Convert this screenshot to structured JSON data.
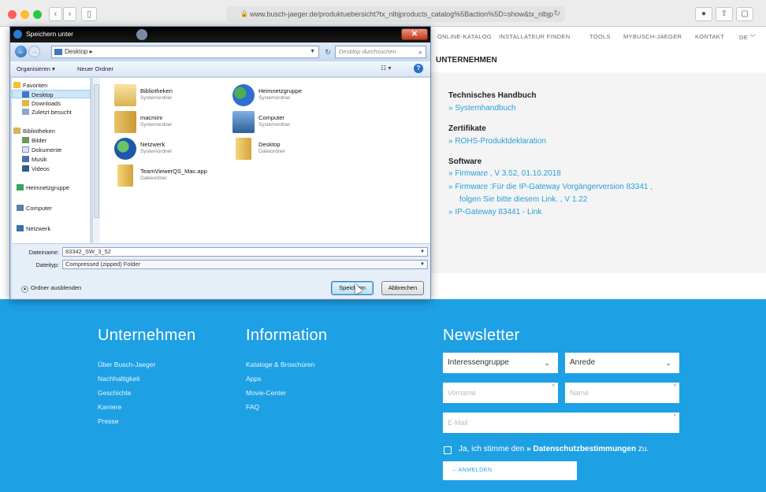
{
  "browser": {
    "url": "www.busch-jaeger.de/produktuebersicht?tx_nlbjproducts_catalog%5Baction%5D=show&tx_nlbjp"
  },
  "site": {
    "nav": [
      "ONLINE-KATALOG",
      "INSTALLATEUR FINDEN",
      "TOOLS",
      "MYBUSCH-JAEGER",
      "KONTAKT",
      "DE"
    ],
    "section_title": "UNTERNEHMEN",
    "downloads": [
      {
        "title": "Technisches Handbuch",
        "links": [
          "» Systemhandbuch"
        ]
      },
      {
        "title": "Zertifikate",
        "links": [
          "» ROHS-Produktdeklaration"
        ]
      },
      {
        "title": "Software",
        "links": [
          "» Firmware , V 3.52, 01.10.2018",
          "» Firmware :Für die IP-Gateway Vorgängerversion 83341 ,",
          "folgen Sie bitte diesem Link. , V 1.22",
          "» IP-Gateway 83441 - Link"
        ]
      }
    ]
  },
  "footer": {
    "col1": {
      "title": "Unternehmen",
      "links": [
        "Über Busch-Jaeger",
        "Nachhaltigkeit",
        "Geschichte",
        "Karriere",
        "Presse"
      ]
    },
    "col2": {
      "title": "Information",
      "links": [
        "Kataloge & Broschüren",
        "Apps",
        "Movie-Center",
        "FAQ"
      ]
    },
    "newsletter": {
      "title": "Newsletter",
      "interest_select": "Interessengruppe",
      "salutation_select": "Anrede",
      "firstname_placeholder": "Vorname",
      "name_placeholder": "Name",
      "email_placeholder": "E-Mail",
      "consent_prefix": "Ja, ich stimme den",
      "consent_link": "» Datenschutzbestimmungen",
      "consent_suffix": "zu.",
      "submit_label": "→  ANMELDEN"
    }
  },
  "dialog": {
    "title": "Speichern unter",
    "address": "Desktop ▸",
    "search_placeholder": "Desktop durchsuchen",
    "toolbar": {
      "organize": "Organisieren ▾",
      "new_folder": "Neuer Ordner"
    },
    "nav_items": [
      {
        "label": "Favoriten",
        "level": 0
      },
      {
        "label": "Desktop",
        "level": 1,
        "selected": true
      },
      {
        "label": "Downloads",
        "level": 1
      },
      {
        "label": "Zuletzt besucht",
        "level": 1
      },
      {
        "label": "Bibliotheken",
        "level": 0
      },
      {
        "label": "Bilder",
        "level": 1
      },
      {
        "label": "Dokumente",
        "level": 1
      },
      {
        "label": "Musik",
        "level": 1
      },
      {
        "label": "Videos",
        "level": 1
      },
      {
        "label": "Heimnetzgruppe",
        "level": 0
      },
      {
        "label": "Computer",
        "level": 0
      },
      {
        "label": "Netzwerk",
        "level": 0
      }
    ],
    "files": [
      {
        "name": "Bibliotheken",
        "type": "Systemordner",
        "icon": "library-icon"
      },
      {
        "name": "Heimnetzgruppe",
        "type": "Systemordner",
        "icon": "homegroup-icon"
      },
      {
        "name": "macmini",
        "type": "Systemordner",
        "icon": "user-folder-icon"
      },
      {
        "name": "Computer",
        "type": "Systemordner",
        "icon": "computer-icon"
      },
      {
        "name": "Netzwerk",
        "type": "Systemordner",
        "icon": "network-icon"
      },
      {
        "name": "Desktop",
        "type": "Dateiordner",
        "icon": "folder-icon"
      },
      {
        "name": "TeamViewerQS_Mac.app",
        "type": "Dateiordner",
        "icon": "folder-icon"
      }
    ],
    "filename_label": "Dateiname:",
    "filename_value": "83342_SW_3_52",
    "filetype_label": "Dateityp:",
    "filetype_value": "Compressed (zipped) Folder",
    "hide_folders": "Ordner ausblenden",
    "save_label": "Speichern",
    "cancel_label": "Abbrechen"
  }
}
